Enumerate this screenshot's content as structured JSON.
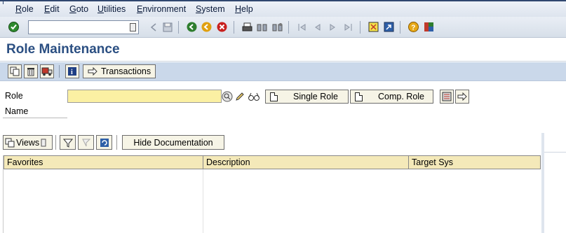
{
  "menu": {
    "items": [
      {
        "label": "Role"
      },
      {
        "label": "Edit"
      },
      {
        "label": "Goto"
      },
      {
        "label": "Utilities"
      },
      {
        "label": "Environment"
      },
      {
        "label": "System"
      },
      {
        "label": "Help"
      }
    ]
  },
  "system_toolbar": {
    "command_field_value": "",
    "icons": [
      "enter-icon",
      "command-dropdown-icon",
      "back-arrow-icon",
      "save-icon",
      "back-icon",
      "exit-icon",
      "cancel-icon",
      "print-icon",
      "find-icon",
      "find-next-icon",
      "first-page-icon",
      "previous-page-icon",
      "next-page-icon",
      "last-page-icon",
      "create-session-icon",
      "shortcut-icon",
      "help-icon",
      "customize-layout-icon"
    ]
  },
  "title": "Role Maintenance",
  "app_toolbar": {
    "transactions_label": "Transactions"
  },
  "form": {
    "role_label": "Role",
    "role_value": "",
    "name_label": "Name",
    "single_role_label": "Single Role",
    "comp_role_label": "Comp. Role"
  },
  "tree_toolbar": {
    "views_label": "Views",
    "hide_doc_label": "Hide Documentation"
  },
  "grid": {
    "columns": [
      "Favorites",
      "Description",
      "Target Sys"
    ]
  },
  "colors": {
    "title_blue": "#2b4f82",
    "input_yellow": "#fbf0a3",
    "header_yellow": "#f4e9b9",
    "toolbar_blue": "#cad8ea"
  }
}
